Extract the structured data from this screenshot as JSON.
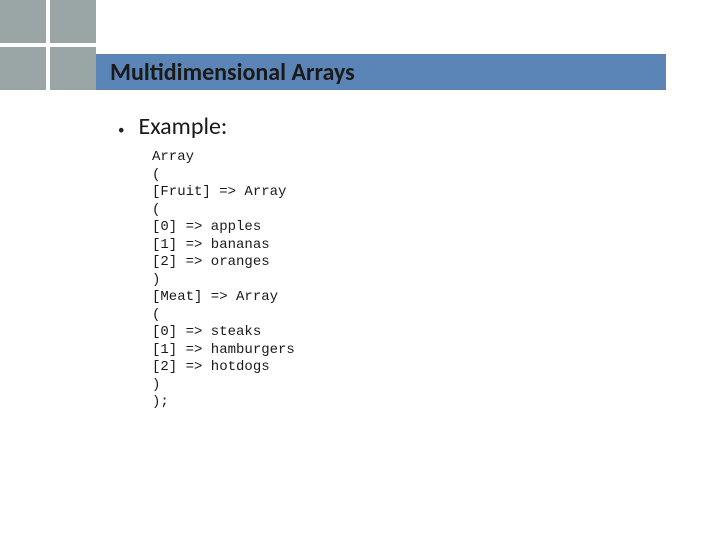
{
  "title": "Multidimensional Arrays",
  "bullet": {
    "marker": "•",
    "text": "Example:"
  },
  "code": "Array\n(\n[Fruit] => Array\n(\n[0] => apples\n[1] => bananas\n[2] => oranges\n)\n[Meat] => Array\n(\n[0] => steaks\n[1] => hamburgers\n[2] => hotdogs\n)\n);"
}
